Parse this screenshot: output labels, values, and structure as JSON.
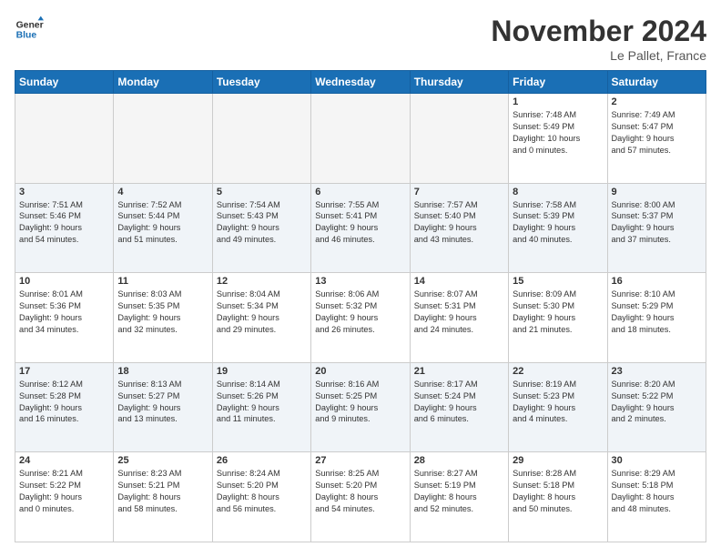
{
  "logo": {
    "line1": "General",
    "line2": "Blue"
  },
  "title": "November 2024",
  "location": "Le Pallet, France",
  "days_header": [
    "Sunday",
    "Monday",
    "Tuesday",
    "Wednesday",
    "Thursday",
    "Friday",
    "Saturday"
  ],
  "weeks": [
    [
      {
        "day": "",
        "info": ""
      },
      {
        "day": "",
        "info": ""
      },
      {
        "day": "",
        "info": ""
      },
      {
        "day": "",
        "info": ""
      },
      {
        "day": "",
        "info": ""
      },
      {
        "day": "1",
        "info": "Sunrise: 7:48 AM\nSunset: 5:49 PM\nDaylight: 10 hours\nand 0 minutes."
      },
      {
        "day": "2",
        "info": "Sunrise: 7:49 AM\nSunset: 5:47 PM\nDaylight: 9 hours\nand 57 minutes."
      }
    ],
    [
      {
        "day": "3",
        "info": "Sunrise: 7:51 AM\nSunset: 5:46 PM\nDaylight: 9 hours\nand 54 minutes."
      },
      {
        "day": "4",
        "info": "Sunrise: 7:52 AM\nSunset: 5:44 PM\nDaylight: 9 hours\nand 51 minutes."
      },
      {
        "day": "5",
        "info": "Sunrise: 7:54 AM\nSunset: 5:43 PM\nDaylight: 9 hours\nand 49 minutes."
      },
      {
        "day": "6",
        "info": "Sunrise: 7:55 AM\nSunset: 5:41 PM\nDaylight: 9 hours\nand 46 minutes."
      },
      {
        "day": "7",
        "info": "Sunrise: 7:57 AM\nSunset: 5:40 PM\nDaylight: 9 hours\nand 43 minutes."
      },
      {
        "day": "8",
        "info": "Sunrise: 7:58 AM\nSunset: 5:39 PM\nDaylight: 9 hours\nand 40 minutes."
      },
      {
        "day": "9",
        "info": "Sunrise: 8:00 AM\nSunset: 5:37 PM\nDaylight: 9 hours\nand 37 minutes."
      }
    ],
    [
      {
        "day": "10",
        "info": "Sunrise: 8:01 AM\nSunset: 5:36 PM\nDaylight: 9 hours\nand 34 minutes."
      },
      {
        "day": "11",
        "info": "Sunrise: 8:03 AM\nSunset: 5:35 PM\nDaylight: 9 hours\nand 32 minutes."
      },
      {
        "day": "12",
        "info": "Sunrise: 8:04 AM\nSunset: 5:34 PM\nDaylight: 9 hours\nand 29 minutes."
      },
      {
        "day": "13",
        "info": "Sunrise: 8:06 AM\nSunset: 5:32 PM\nDaylight: 9 hours\nand 26 minutes."
      },
      {
        "day": "14",
        "info": "Sunrise: 8:07 AM\nSunset: 5:31 PM\nDaylight: 9 hours\nand 24 minutes."
      },
      {
        "day": "15",
        "info": "Sunrise: 8:09 AM\nSunset: 5:30 PM\nDaylight: 9 hours\nand 21 minutes."
      },
      {
        "day": "16",
        "info": "Sunrise: 8:10 AM\nSunset: 5:29 PM\nDaylight: 9 hours\nand 18 minutes."
      }
    ],
    [
      {
        "day": "17",
        "info": "Sunrise: 8:12 AM\nSunset: 5:28 PM\nDaylight: 9 hours\nand 16 minutes."
      },
      {
        "day": "18",
        "info": "Sunrise: 8:13 AM\nSunset: 5:27 PM\nDaylight: 9 hours\nand 13 minutes."
      },
      {
        "day": "19",
        "info": "Sunrise: 8:14 AM\nSunset: 5:26 PM\nDaylight: 9 hours\nand 11 minutes."
      },
      {
        "day": "20",
        "info": "Sunrise: 8:16 AM\nSunset: 5:25 PM\nDaylight: 9 hours\nand 9 minutes."
      },
      {
        "day": "21",
        "info": "Sunrise: 8:17 AM\nSunset: 5:24 PM\nDaylight: 9 hours\nand 6 minutes."
      },
      {
        "day": "22",
        "info": "Sunrise: 8:19 AM\nSunset: 5:23 PM\nDaylight: 9 hours\nand 4 minutes."
      },
      {
        "day": "23",
        "info": "Sunrise: 8:20 AM\nSunset: 5:22 PM\nDaylight: 9 hours\nand 2 minutes."
      }
    ],
    [
      {
        "day": "24",
        "info": "Sunrise: 8:21 AM\nSunset: 5:22 PM\nDaylight: 9 hours\nand 0 minutes."
      },
      {
        "day": "25",
        "info": "Sunrise: 8:23 AM\nSunset: 5:21 PM\nDaylight: 8 hours\nand 58 minutes."
      },
      {
        "day": "26",
        "info": "Sunrise: 8:24 AM\nSunset: 5:20 PM\nDaylight: 8 hours\nand 56 minutes."
      },
      {
        "day": "27",
        "info": "Sunrise: 8:25 AM\nSunset: 5:20 PM\nDaylight: 8 hours\nand 54 minutes."
      },
      {
        "day": "28",
        "info": "Sunrise: 8:27 AM\nSunset: 5:19 PM\nDaylight: 8 hours\nand 52 minutes."
      },
      {
        "day": "29",
        "info": "Sunrise: 8:28 AM\nSunset: 5:18 PM\nDaylight: 8 hours\nand 50 minutes."
      },
      {
        "day": "30",
        "info": "Sunrise: 8:29 AM\nSunset: 5:18 PM\nDaylight: 8 hours\nand 48 minutes."
      }
    ]
  ]
}
